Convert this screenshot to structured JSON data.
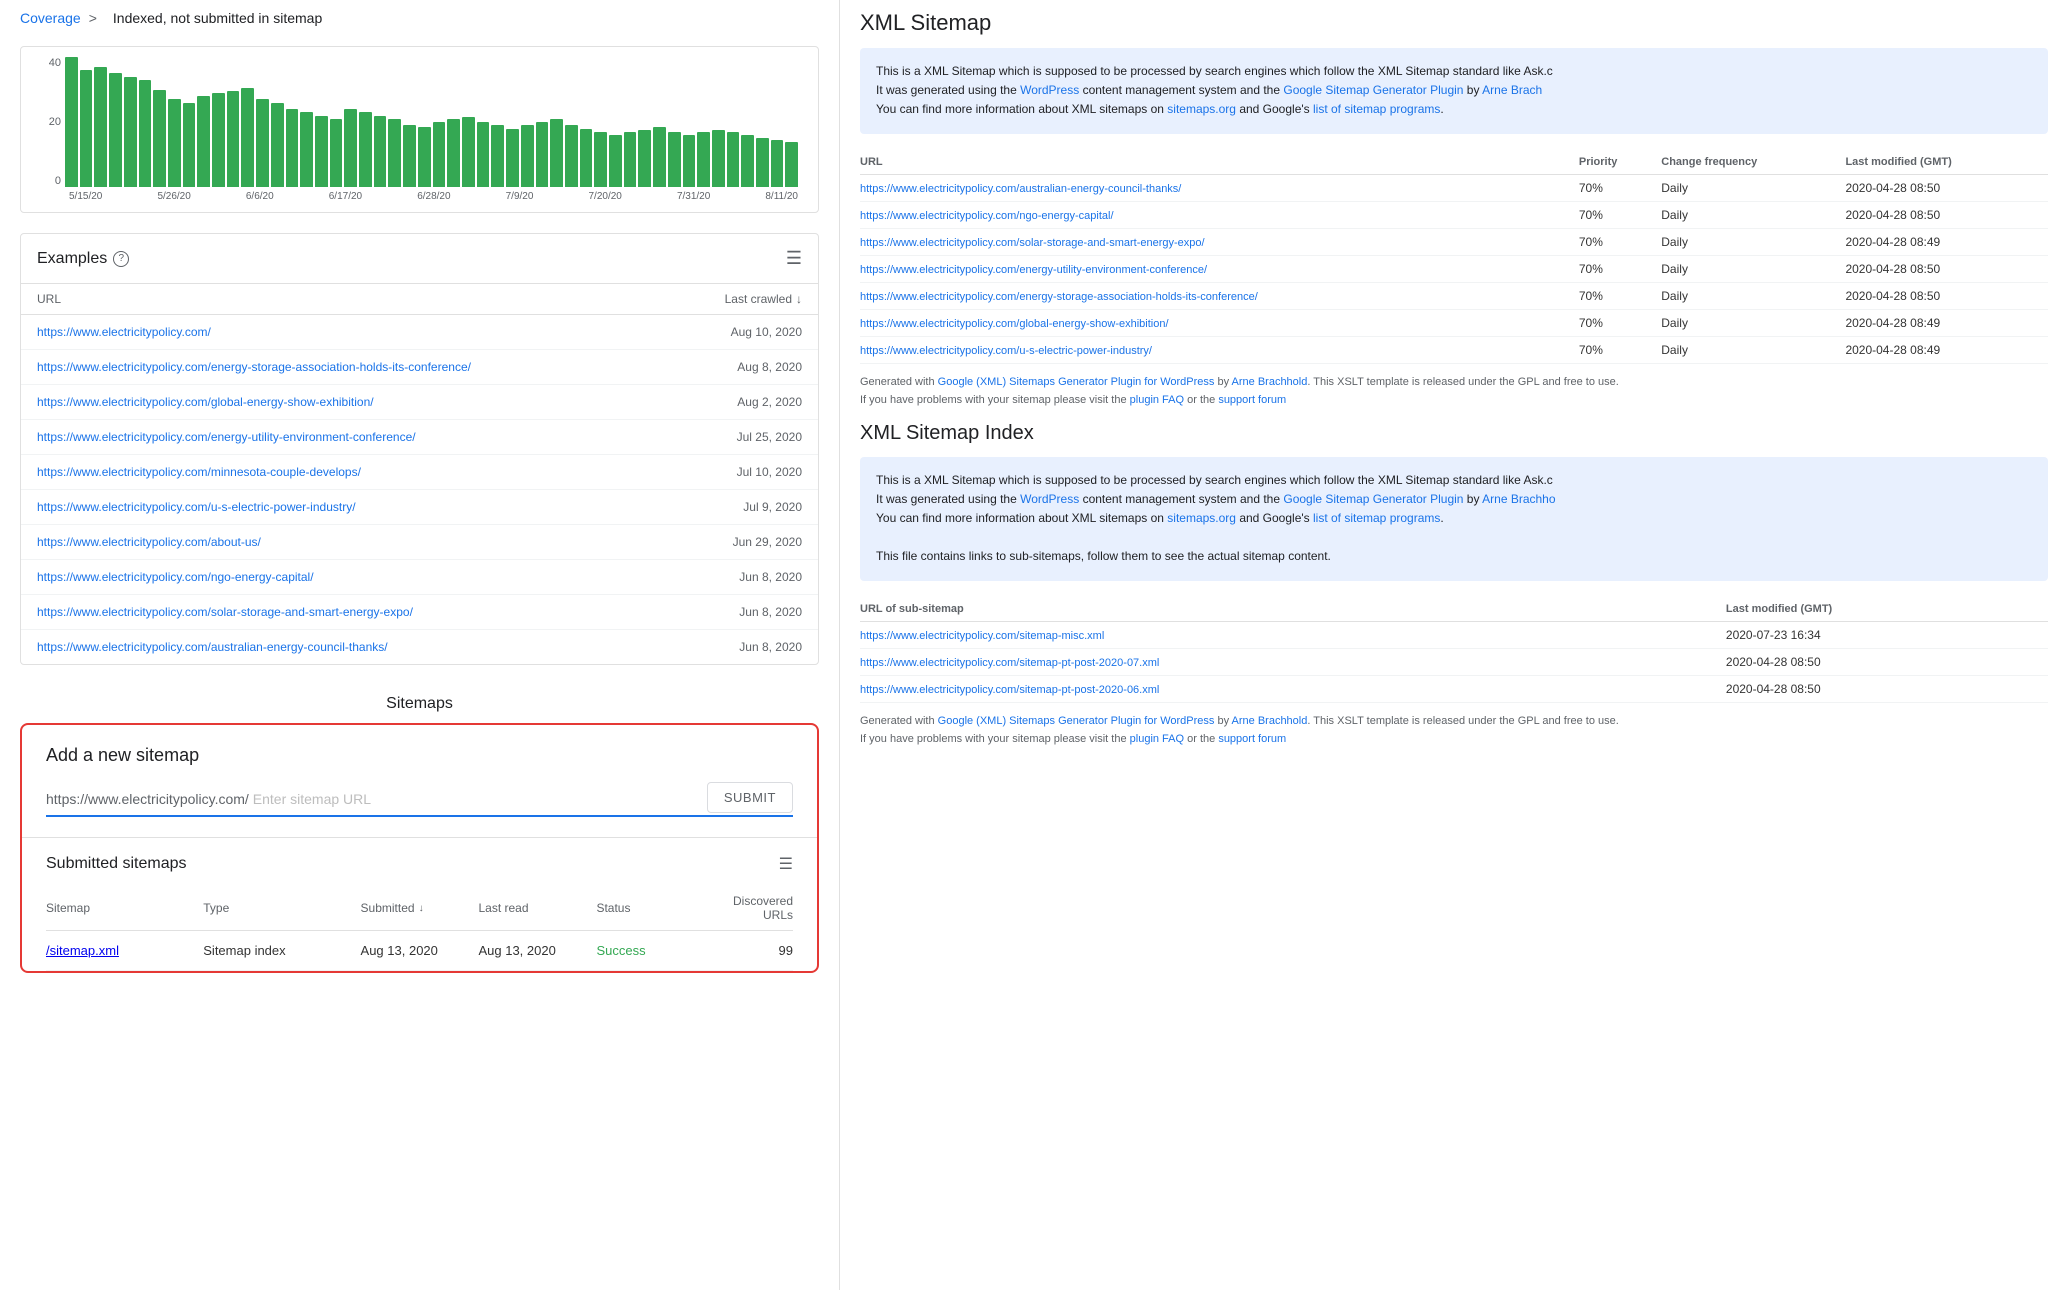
{
  "breadcrumb": {
    "parent": "Coverage",
    "separator": ">",
    "current": "Indexed, not submitted in sitemap"
  },
  "chart": {
    "y_labels": [
      "40",
      "20",
      "0"
    ],
    "x_labels": [
      "5/15/20",
      "5/26/20",
      "6/6/20",
      "6/17/20",
      "6/28/20",
      "7/9/20",
      "7/20/20",
      "7/31/20",
      "8/11/20"
    ],
    "bars": [
      100,
      90,
      92,
      88,
      85,
      82,
      75,
      68,
      65,
      70,
      72,
      74,
      76,
      68,
      65,
      60,
      58,
      55,
      52,
      60,
      58,
      55,
      52,
      48,
      46,
      50,
      52,
      54,
      50,
      48,
      45,
      48,
      50,
      52,
      48,
      45,
      42,
      40,
      42,
      44,
      46,
      42,
      40,
      42,
      44,
      42,
      40,
      38,
      36,
      35
    ]
  },
  "examples": {
    "title": "Examples",
    "info_icon": "?",
    "col_url": "URL",
    "col_last_crawled": "Last crawled",
    "urls": [
      {
        "url": "https://www.electricitypolicy.com/",
        "date": "Aug 10, 2020"
      },
      {
        "url": "https://www.electricitypolicy.com/energy-storage-association-holds-its-conference/",
        "date": "Aug 8, 2020"
      },
      {
        "url": "https://www.electricitypolicy.com/global-energy-show-exhibition/",
        "date": "Aug 2, 2020"
      },
      {
        "url": "https://www.electricitypolicy.com/energy-utility-environment-conference/",
        "date": "Jul 25, 2020"
      },
      {
        "url": "https://www.electricitypolicy.com/minnesota-couple-develops/",
        "date": "Jul 10, 2020"
      },
      {
        "url": "https://www.electricitypolicy.com/u-s-electric-power-industry/",
        "date": "Jul 9, 2020"
      },
      {
        "url": "https://www.electricitypolicy.com/about-us/",
        "date": "Jun 29, 2020"
      },
      {
        "url": "https://www.electricitypolicy.com/ngo-energy-capital/",
        "date": "Jun 8, 2020"
      },
      {
        "url": "https://www.electricitypolicy.com/solar-storage-and-smart-energy-expo/",
        "date": "Jun 8, 2020"
      },
      {
        "url": "https://www.electricitypolicy.com/australian-energy-council-thanks/",
        "date": "Jun 8, 2020"
      }
    ]
  },
  "sitemaps": {
    "section_title": "Sitemaps",
    "add_sitemap": {
      "title": "Add a new sitemap",
      "prefix": "https://www.electricitypolicy.com/",
      "placeholder": "Enter sitemap URL",
      "submit_label": "SUBMIT"
    },
    "submitted_sitemaps": {
      "title": "Submitted sitemaps",
      "filter_icon": "≡",
      "columns": {
        "sitemap": "Sitemap",
        "type": "Type",
        "submitted": "Submitted",
        "last_read": "Last read",
        "status": "Status",
        "discovered_urls": "Discovered URLs"
      },
      "rows": [
        {
          "sitemap": "/sitemap.xml",
          "type": "Sitemap index",
          "submitted": "Aug 13, 2020",
          "last_read": "Aug 13, 2020",
          "status": "Success",
          "discovered_urls": "99"
        }
      ]
    }
  },
  "xml_sitemap": {
    "title": "XML Sitemap",
    "info_text_1": "This is a XML Sitemap which is supposed to be processed by search engines which follow the XML Sitemap standard like Ask.c",
    "info_text_2": "It was generated using the",
    "wordpress_link": "WordPress",
    "info_text_3": "content management system and the",
    "plugin_link": "Google Sitemap Generator Plugin",
    "info_text_4": "by",
    "arne_link": "Arne Brach",
    "info_text_5": "You can find more information about XML sitemaps on",
    "sitemaps_org_link": "sitemaps.org",
    "info_text_6": "and Google's",
    "list_link": "list of sitemap programs",
    "table": {
      "col_url": "URL",
      "col_priority": "Priority",
      "col_change_freq": "Change frequency",
      "col_last_modified": "Last modified (GMT)",
      "rows": [
        {
          "url": "https://www.electricitypolicy.com/australian-energy-council-thanks/",
          "priority": "70%",
          "change_freq": "Daily",
          "last_modified": "2020-04-28 08:50"
        },
        {
          "url": "https://www.electricitypolicy.com/ngo-energy-capital/",
          "priority": "70%",
          "change_freq": "Daily",
          "last_modified": "2020-04-28 08:50"
        },
        {
          "url": "https://www.electricitypolicy.com/solar-storage-and-smart-energy-expo/",
          "priority": "70%",
          "change_freq": "Daily",
          "last_modified": "2020-04-28 08:49"
        },
        {
          "url": "https://www.electricitypolicy.com/energy-utility-environment-conference/",
          "priority": "70%",
          "change_freq": "Daily",
          "last_modified": "2020-04-28 08:50"
        },
        {
          "url": "https://www.electricitypolicy.com/energy-storage-association-holds-its-conference/",
          "priority": "70%",
          "change_freq": "Daily",
          "last_modified": "2020-04-28 08:50"
        },
        {
          "url": "https://www.electricitypolicy.com/global-energy-show-exhibition/",
          "priority": "70%",
          "change_freq": "Daily",
          "last_modified": "2020-04-28 08:49"
        },
        {
          "url": "https://www.electricitypolicy.com/u-s-electric-power-industry/",
          "priority": "70%",
          "change_freq": "Daily",
          "last_modified": "2020-04-28 08:49"
        }
      ]
    },
    "generated_text": "Generated with",
    "generated_link": "Google (XML) Sitemaps Generator Plugin for WordPress",
    "generated_by": "by",
    "arne_link2": "Arne Brachhold",
    "generated_suffix": ". This XSLT template is released under the GPL and free to use.",
    "problem_text": "If you have problems with your sitemap please visit the",
    "plugin_faq_link": "plugin FAQ",
    "or_text": "or the",
    "support_forum_link": "support forum"
  },
  "xml_sitemap_index": {
    "title": "XML Sitemap Index",
    "info_text": "This is a XML Sitemap which is supposed to be processed by search engines which follow the XML Sitemap standard like Ask.c It was generated using the WordPress content management system and the Google Sitemap Generator Plugin by Arne Brachho You can find more information about XML sitemaps on sitemaps.org and Google's list of sitemap programs.",
    "file_links_text": "This file contains links to sub-sitemaps, follow them to see the actual sitemap content.",
    "table": {
      "col_url": "URL of sub-sitemap",
      "col_last_modified": "Last modified (GMT)",
      "rows": [
        {
          "url": "https://www.electricitypolicy.com/sitemap-misc.xml",
          "last_modified": "2020-07-23 16:34"
        },
        {
          "url": "https://www.electricitypolicy.com/sitemap-pt-post-2020-07.xml",
          "last_modified": "2020-04-28 08:50"
        },
        {
          "url": "https://www.electricitypolicy.com/sitemap-pt-post-2020-06.xml",
          "last_modified": "2020-04-28 08:50"
        }
      ]
    },
    "generated_text": "Generated with",
    "generated_link": "Google (XML) Sitemaps Generator Plugin for WordPress",
    "generated_by": "by",
    "arne_link": "Arne Brachhold",
    "generated_suffix": ". This XSLT template is released under the GPL and free to use.",
    "problem_text": "If you have problems with your sitemap please visit the",
    "plugin_faq_link": "plugin FAQ",
    "or_text": "or the",
    "support_forum_link": "support forum"
  }
}
